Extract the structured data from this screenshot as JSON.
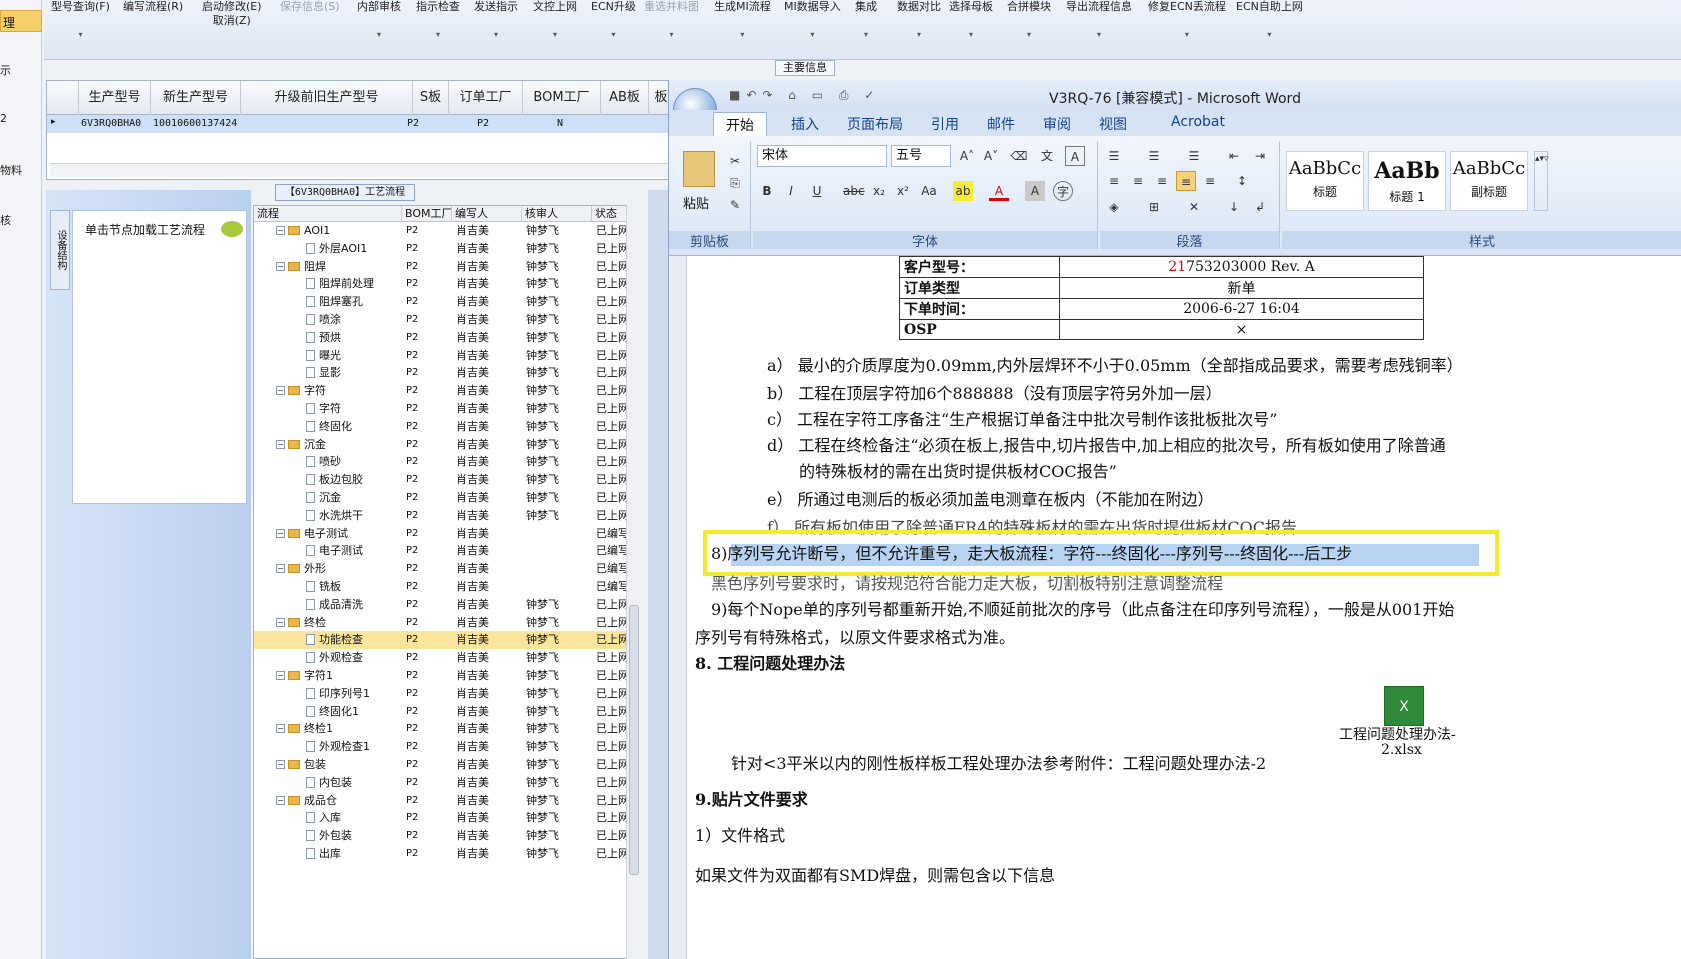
{
  "left_strip": {
    "items": [
      "理",
      "示",
      "2",
      "物料",
      "核"
    ]
  },
  "toolbar": {
    "buttons": [
      {
        "label": "型号查询(F)",
        "dis": false
      },
      {
        "label": "编写流程(R)",
        "dis": false
      },
      {
        "label": "启动修改(E)",
        "sub": "取消(Z)",
        "dis": false
      },
      {
        "label": "保存信息(S)",
        "dis": true
      },
      {
        "label": "内部审核",
        "dis": false
      },
      {
        "label": "指示检查",
        "dis": false
      },
      {
        "label": "发送指示",
        "dis": false
      },
      {
        "label": "文控上网",
        "dis": false
      },
      {
        "label": "ECN升级",
        "dis": false
      },
      {
        "label": "重选并料图",
        "dis": true
      },
      {
        "label": "生成MI流程",
        "dis": false
      },
      {
        "label": "MI数据导入",
        "dis": false
      },
      {
        "label": "集成",
        "dis": false
      },
      {
        "label": "数据对比",
        "dis": false
      },
      {
        "label": "选择母板",
        "dis": false
      },
      {
        "label": "合拼模块",
        "dis": false
      },
      {
        "label": "导出流程信息",
        "dis": false
      },
      {
        "label": "修复ECN丢流程",
        "dis": false
      },
      {
        "label": "ECN自助上网",
        "dis": false
      }
    ],
    "main_info": "主要信息"
  },
  "grid": {
    "headers": [
      "生产型号",
      "新生产型号",
      "升级前旧生产型号",
      "S板",
      "订单工厂",
      "BOM工厂",
      "AB板",
      "板厚",
      "板"
    ],
    "row": [
      "6V3RQ0BHA0",
      "10010600137424",
      "",
      "",
      "P2",
      "P2",
      "N",
      "",
      ""
    ]
  },
  "panel": {
    "title": "【6V3RQ0BHA0】工艺流程",
    "vtab": "设备结构",
    "node_hint": "单击节点加载工艺流程"
  },
  "tree": {
    "headers": [
      "流程",
      "BOM工厂",
      "编写人",
      "核审人",
      "状态"
    ],
    "rows": [
      {
        "name": "AOI1",
        "lvl": 0,
        "f": "P2",
        "w": "肖吉美",
        "r": "钟梦飞",
        "s": "已上网"
      },
      {
        "name": "外层AOI1",
        "lvl": 1,
        "f": "P2",
        "w": "肖吉美",
        "r": "钟梦飞",
        "s": "已上网"
      },
      {
        "name": "阻焊",
        "lvl": 0,
        "f": "P2",
        "w": "肖吉美",
        "r": "钟梦飞",
        "s": "已上网"
      },
      {
        "name": "阻焊前处理",
        "lvl": 1,
        "f": "P2",
        "w": "肖吉美",
        "r": "钟梦飞",
        "s": "已上网"
      },
      {
        "name": "阻焊塞孔",
        "lvl": 1,
        "f": "P2",
        "w": "肖吉美",
        "r": "钟梦飞",
        "s": "已上网"
      },
      {
        "name": "喷涂",
        "lvl": 1,
        "f": "P2",
        "w": "肖吉美",
        "r": "钟梦飞",
        "s": "已上网"
      },
      {
        "name": "预烘",
        "lvl": 1,
        "f": "P2",
        "w": "肖吉美",
        "r": "钟梦飞",
        "s": "已上网"
      },
      {
        "name": "曝光",
        "lvl": 1,
        "f": "P2",
        "w": "肖吉美",
        "r": "钟梦飞",
        "s": "已上网"
      },
      {
        "name": "显影",
        "lvl": 1,
        "f": "P2",
        "w": "肖吉美",
        "r": "钟梦飞",
        "s": "已上网"
      },
      {
        "name": "字符",
        "lvl": 0,
        "f": "P2",
        "w": "肖吉美",
        "r": "钟梦飞",
        "s": "已上网"
      },
      {
        "name": "字符",
        "lvl": 1,
        "f": "P2",
        "w": "肖吉美",
        "r": "钟梦飞",
        "s": "已上网"
      },
      {
        "name": "终固化",
        "lvl": 1,
        "f": "P2",
        "w": "肖吉美",
        "r": "钟梦飞",
        "s": "已上网"
      },
      {
        "name": "沉金",
        "lvl": 0,
        "f": "P2",
        "w": "肖吉美",
        "r": "钟梦飞",
        "s": "已上网"
      },
      {
        "name": "喷砂",
        "lvl": 1,
        "f": "P2",
        "w": "肖吉美",
        "r": "钟梦飞",
        "s": "已上网"
      },
      {
        "name": "板边包胶",
        "lvl": 1,
        "f": "P2",
        "w": "肖吉美",
        "r": "钟梦飞",
        "s": "已上网"
      },
      {
        "name": "沉金",
        "lvl": 1,
        "f": "P2",
        "w": "肖吉美",
        "r": "钟梦飞",
        "s": "已上网"
      },
      {
        "name": "水洗烘干",
        "lvl": 1,
        "f": "P2",
        "w": "肖吉美",
        "r": "钟梦飞",
        "s": "已上网"
      },
      {
        "name": "电子测试",
        "lvl": 0,
        "f": "P2",
        "w": "肖吉美",
        "r": "",
        "s": "已编写"
      },
      {
        "name": "电子测试",
        "lvl": 1,
        "f": "P2",
        "w": "肖吉美",
        "r": "",
        "s": "已编写"
      },
      {
        "name": "外形",
        "lvl": 0,
        "f": "P2",
        "w": "肖吉美",
        "r": "",
        "s": "已编写"
      },
      {
        "name": "铣板",
        "lvl": 1,
        "f": "P2",
        "w": "肖吉美",
        "r": "",
        "s": "已编写"
      },
      {
        "name": "成品清洗",
        "lvl": 1,
        "f": "P2",
        "w": "肖吉美",
        "r": "钟梦飞",
        "s": "已上网"
      },
      {
        "name": "终检",
        "lvl": 0,
        "f": "P2",
        "w": "肖吉美",
        "r": "钟梦飞",
        "s": "已上网"
      },
      {
        "name": "功能检查",
        "lvl": 1,
        "f": "P2",
        "w": "肖吉美",
        "r": "钟梦飞",
        "s": "已上网",
        "sel": true
      },
      {
        "name": "外观检查",
        "lvl": 1,
        "f": "P2",
        "w": "肖吉美",
        "r": "钟梦飞",
        "s": "已上网"
      },
      {
        "name": "字符1",
        "lvl": 0,
        "f": "P2",
        "w": "肖吉美",
        "r": "钟梦飞",
        "s": "已上网"
      },
      {
        "name": "印序列号1",
        "lvl": 1,
        "f": "P2",
        "w": "肖吉美",
        "r": "钟梦飞",
        "s": "已上网"
      },
      {
        "name": "终固化1",
        "lvl": 1,
        "f": "P2",
        "w": "肖吉美",
        "r": "钟梦飞",
        "s": "已上网"
      },
      {
        "name": "终检1",
        "lvl": 0,
        "f": "P2",
        "w": "肖吉美",
        "r": "钟梦飞",
        "s": "已上网"
      },
      {
        "name": "外观检查1",
        "lvl": 1,
        "f": "P2",
        "w": "肖吉美",
        "r": "钟梦飞",
        "s": "已上网"
      },
      {
        "name": "包装",
        "lvl": 0,
        "f": "P2",
        "w": "肖吉美",
        "r": "钟梦飞",
        "s": "已上网"
      },
      {
        "name": "内包装",
        "lvl": 1,
        "f": "P2",
        "w": "肖吉美",
        "r": "钟梦飞",
        "s": "已上网"
      },
      {
        "name": "成品仓",
        "lvl": 0,
        "f": "P2",
        "w": "肖吉美",
        "r": "钟梦飞",
        "s": "已上网"
      },
      {
        "name": "入库",
        "lvl": 1,
        "f": "P2",
        "w": "肖吉美",
        "r": "钟梦飞",
        "s": "已上网"
      },
      {
        "name": "外包装",
        "lvl": 1,
        "f": "P2",
        "w": "肖吉美",
        "r": "钟梦飞",
        "s": "已上网"
      },
      {
        "name": "出库",
        "lvl": 1,
        "f": "P2",
        "w": "肖吉美",
        "r": "钟梦飞",
        "s": "已上网"
      }
    ]
  },
  "word": {
    "title": "V3RQ-76 [兼容模式] - Microsoft Word",
    "tabs": [
      "开始",
      "插入",
      "页面布局",
      "引用",
      "邮件",
      "审阅",
      "视图",
      "Acrobat"
    ],
    "paste": "粘贴",
    "clipboard": "剪贴板",
    "font_name": "宋体",
    "font_size": "五号",
    "font_grp": "字体",
    "para_grp": "段落",
    "style_grp": "样式",
    "styles": [
      {
        "preview": "AaBbCc",
        "name": "标题"
      },
      {
        "preview": "AaBb",
        "name": "标题 1"
      },
      {
        "preview": "AaBbCc",
        "name": "副标题"
      }
    ]
  },
  "doc": {
    "table": [
      [
        "客户型号：",
        "21753203000 Rev. A"
      ],
      [
        "订单类型",
        "新单"
      ],
      [
        "下单时间：",
        "2006-6-27 16:04"
      ],
      [
        "OSP",
        "×"
      ]
    ],
    "lines": [
      "a） 最小的介质厚度为0.09mm,内外层焊环不小于0.05mm（全部指成品要求，需要考虑残铜率）",
      "b） 工程在顶层字符加6个888888（没有顶层字符另外加一层）",
      "c） 工程在字符工序备注“生产根据订单备注中批次号制作该批板批次号”",
      "d） 工程在终检备注“必须在板上,报告中,切片报告中,加上相应的批次号，所有板如使用了除普通",
      "的特殊板材的需在出货时提供板材COC报告”",
      "e） 所通过电测后的板必须加盖电测章在板内（不能加在附边）",
      "f） 所有板如使用了除普通FR4的特殊板材的需在出货时提供板材COC报告"
    ],
    "hl_line": "8)序列号允许断号，但不允许重号，走大板流程：字符---终固化---序列号---终固化---后工步",
    "after_hl": "黑色序列号要求时，请按规范符合能力走大板，切割板特别注意调整流程",
    "p9a": "9)每个Nope单的序列号都重新开始,不顺延前批次的序号（此点备注在印序列号流程），一般是从001开始",
    "p9b": "序列号有特殊格式，以原文件要求格式为准。",
    "h8": "8.  工程问题处理办法",
    "attach": "工程问题处理办法-",
    "attach2": "2.xlsx",
    "note": "针对<3平米以内的刚性板样板工程处理办法参考附件：工程问题处理办法-2",
    "h9": "9.贴片文件要求",
    "fmt": "1）文件格式",
    "last": "如果文件为双面都有SMD焊盘，则需包含以下信息"
  }
}
